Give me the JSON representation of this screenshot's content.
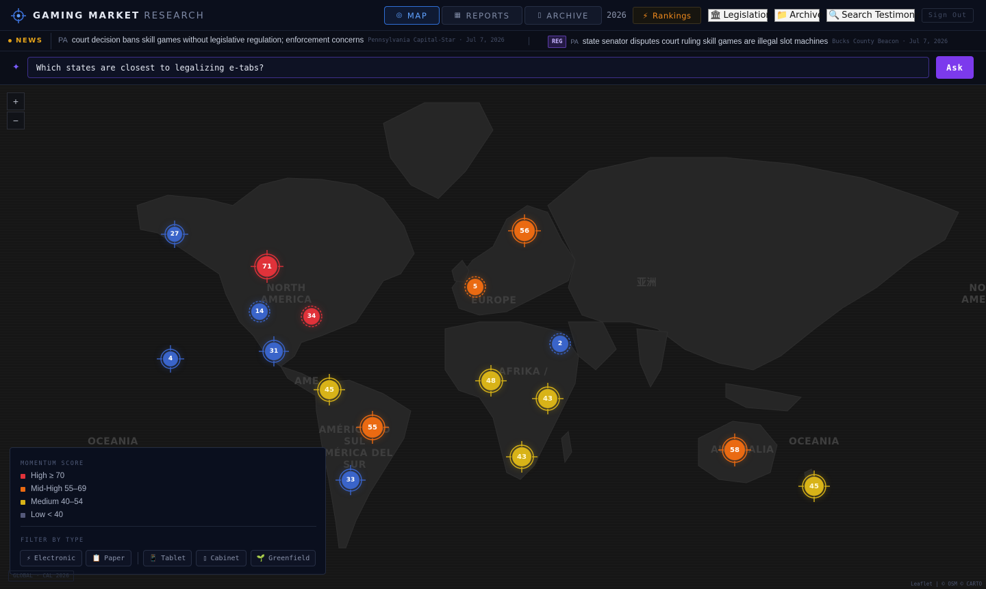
{
  "header": {
    "brand_primary": "GAMING MARKET",
    "brand_secondary": "RESEARCH",
    "nav": [
      {
        "label": "MAP",
        "icon": "◎",
        "active": true
      },
      {
        "label": "REPORTS",
        "icon": "▦",
        "active": false
      },
      {
        "label": "ARCHIVE",
        "icon": "▯",
        "active": false
      }
    ],
    "year": "2026",
    "rankings_label": "Rankings",
    "rankings_icon": "⚡",
    "legislation_label": "Legislation",
    "legislation_icon": "🏛",
    "archive_label": "Archive",
    "archive_icon": "📁",
    "search_testimony_label": "Search Testimony",
    "search_testimony_icon": "🔍",
    "signout_label": "Sign Out"
  },
  "news": {
    "label": "NEWS",
    "items": [
      {
        "state": "PA",
        "headline": "court decision bans skill games without legislative regulation; enforcement concerns",
        "source": "Pennsylvania Capital-Star · Jul 7, 2026"
      },
      {
        "tag": "REG",
        "state": "PA",
        "headline": "state senator disputes court ruling skill games are illegal slot machines",
        "source": "Bucks County Beacon · Jul 7, 2026"
      }
    ]
  },
  "ask": {
    "value": "Which states are closest to legalizing e-tabs?",
    "button_label": "Ask"
  },
  "map": {
    "labels": {
      "north_america": [
        "NORTH",
        "AMERICA"
      ],
      "europe": "EUROPE",
      "asia": "亚洲",
      "africa": "AFRIKA /",
      "south_america_partial": "AME",
      "south_america": [
        "AMÉRICA DO SUL",
        "AMÉRICA DEL SUR"
      ],
      "oceania_left": "OCEANIA",
      "oceania_right": "OCEANIA",
      "australia": "AUSTRALIA",
      "edge_right": [
        "NO",
        "AME"
      ]
    },
    "markers": [
      {
        "value": "27",
        "level": "low"
      },
      {
        "value": "71",
        "level": "high"
      },
      {
        "value": "14",
        "level": "low",
        "dashed": true
      },
      {
        "value": "34",
        "level": "high",
        "dashed": true
      },
      {
        "value": "4",
        "level": "low"
      },
      {
        "value": "31",
        "level": "low"
      },
      {
        "value": "45",
        "level": "medium"
      },
      {
        "value": "55",
        "level": "midhigh"
      },
      {
        "value": "33",
        "level": "low"
      },
      {
        "value": "56",
        "level": "midhigh"
      },
      {
        "value": "5",
        "level": "midhigh",
        "dashed": true
      },
      {
        "value": "2",
        "level": "low",
        "dashed": true
      },
      {
        "value": "48",
        "level": "medium"
      },
      {
        "value": "43",
        "level": "medium"
      },
      {
        "value": "43",
        "level": "medium"
      },
      {
        "value": "58",
        "level": "midhigh"
      },
      {
        "value": "45",
        "level": "medium"
      }
    ],
    "colors": {
      "high": "#e0323a",
      "midhigh": "#ea6a12",
      "medium": "#d8b318",
      "low": "#3a64c9"
    },
    "attribution": "Leaflet | © OSM © CARTO"
  },
  "legend": {
    "title": "MOMENTUM SCORE",
    "rows": [
      {
        "label": "High ≥ 70",
        "color": "#e0323a"
      },
      {
        "label": "Mid-High 55–69",
        "color": "#ea6a12"
      },
      {
        "label": "Medium 40–54",
        "color": "#d8b318"
      },
      {
        "label": "Low < 40",
        "color": "#54597a"
      }
    ],
    "filter_title": "FILTER BY TYPE",
    "filters": [
      {
        "label": "Electronic",
        "icon": "⚡"
      },
      {
        "label": "Paper",
        "icon": "📋"
      },
      {
        "label": "Tablet",
        "icon": "📱"
      },
      {
        "label": "Cabinet",
        "icon": "▯"
      },
      {
        "label": "Greenfield",
        "icon": "🌱"
      }
    ]
  },
  "footer_tag": "GLOBAL · CAL 2026"
}
